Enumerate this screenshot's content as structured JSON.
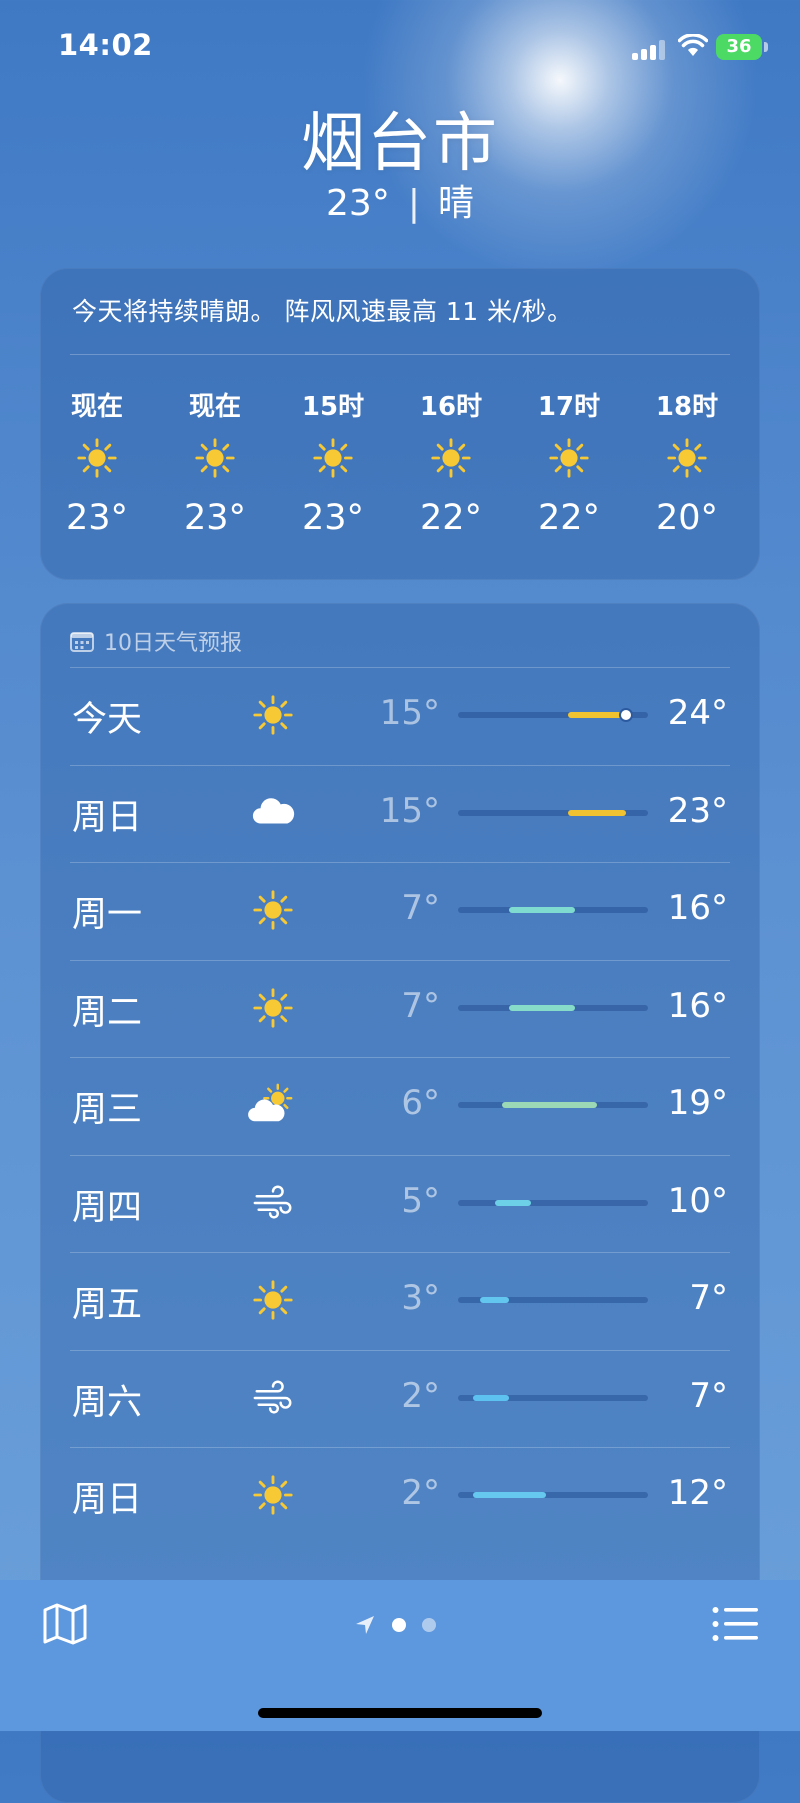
{
  "status": {
    "time": "14:02",
    "battery": "36"
  },
  "location": {
    "city": "烟台市",
    "temp": "23°",
    "condition": "晴"
  },
  "hourly": {
    "summary": "今天将持续晴朗。 阵风风速最高 11 米/秒。",
    "items": [
      {
        "label": "现在",
        "icon": "sun-icon",
        "temp": "23°"
      },
      {
        "label": "现在",
        "icon": "sun-icon",
        "temp": "23°"
      },
      {
        "label": "15时",
        "icon": "sun-icon",
        "temp": "23°"
      },
      {
        "label": "16时",
        "icon": "sun-icon",
        "temp": "22°"
      },
      {
        "label": "17时",
        "icon": "sun-icon",
        "temp": "22°"
      },
      {
        "label": "18时",
        "icon": "sun-icon",
        "temp": "20°"
      }
    ]
  },
  "forecast": {
    "header": "10日天气预报",
    "range": {
      "min": 0,
      "max": 26
    },
    "days": [
      {
        "day": "今天",
        "icon": "sun-icon",
        "low": "15°",
        "high": "24°",
        "low_value": 15,
        "high_value": 24,
        "current_value": 23,
        "color": "#f2c330"
      },
      {
        "day": "周日",
        "icon": "cloud-icon",
        "low": "15°",
        "high": "23°",
        "low_value": 15,
        "high_value": 23,
        "color": "#f0c232"
      },
      {
        "day": "周一",
        "icon": "sun-icon",
        "low": "7°",
        "high": "16°",
        "low_value": 7,
        "high_value": 16,
        "color": "#7fdbd0"
      },
      {
        "day": "周二",
        "icon": "sun-icon",
        "low": "7°",
        "high": "16°",
        "low_value": 7,
        "high_value": 16,
        "color": "#86dcc8"
      },
      {
        "day": "周三",
        "icon": "partly-cloudy-icon",
        "low": "6°",
        "high": "19°",
        "low_value": 6,
        "high_value": 19,
        "color": "#9ad8b6"
      },
      {
        "day": "周四",
        "icon": "wind-icon",
        "low": "5°",
        "high": "10°",
        "low_value": 5,
        "high_value": 10,
        "color": "#6ed0e6"
      },
      {
        "day": "周五",
        "icon": "sun-icon",
        "low": "3°",
        "high": "7°",
        "low_value": 3,
        "high_value": 7,
        "color": "#62c6ee"
      },
      {
        "day": "周六",
        "icon": "wind-icon",
        "low": "2°",
        "high": "7°",
        "low_value": 2,
        "high_value": 7,
        "color": "#5ec2f0"
      },
      {
        "day": "周日",
        "icon": "sun-icon",
        "low": "2°",
        "high": "12°",
        "low_value": 2,
        "high_value": 12,
        "color": "#66c8ee"
      }
    ]
  },
  "tabbar": {
    "map_icon": "map-icon",
    "location_icon": "location-arrow-icon",
    "list_icon": "list-icon"
  }
}
